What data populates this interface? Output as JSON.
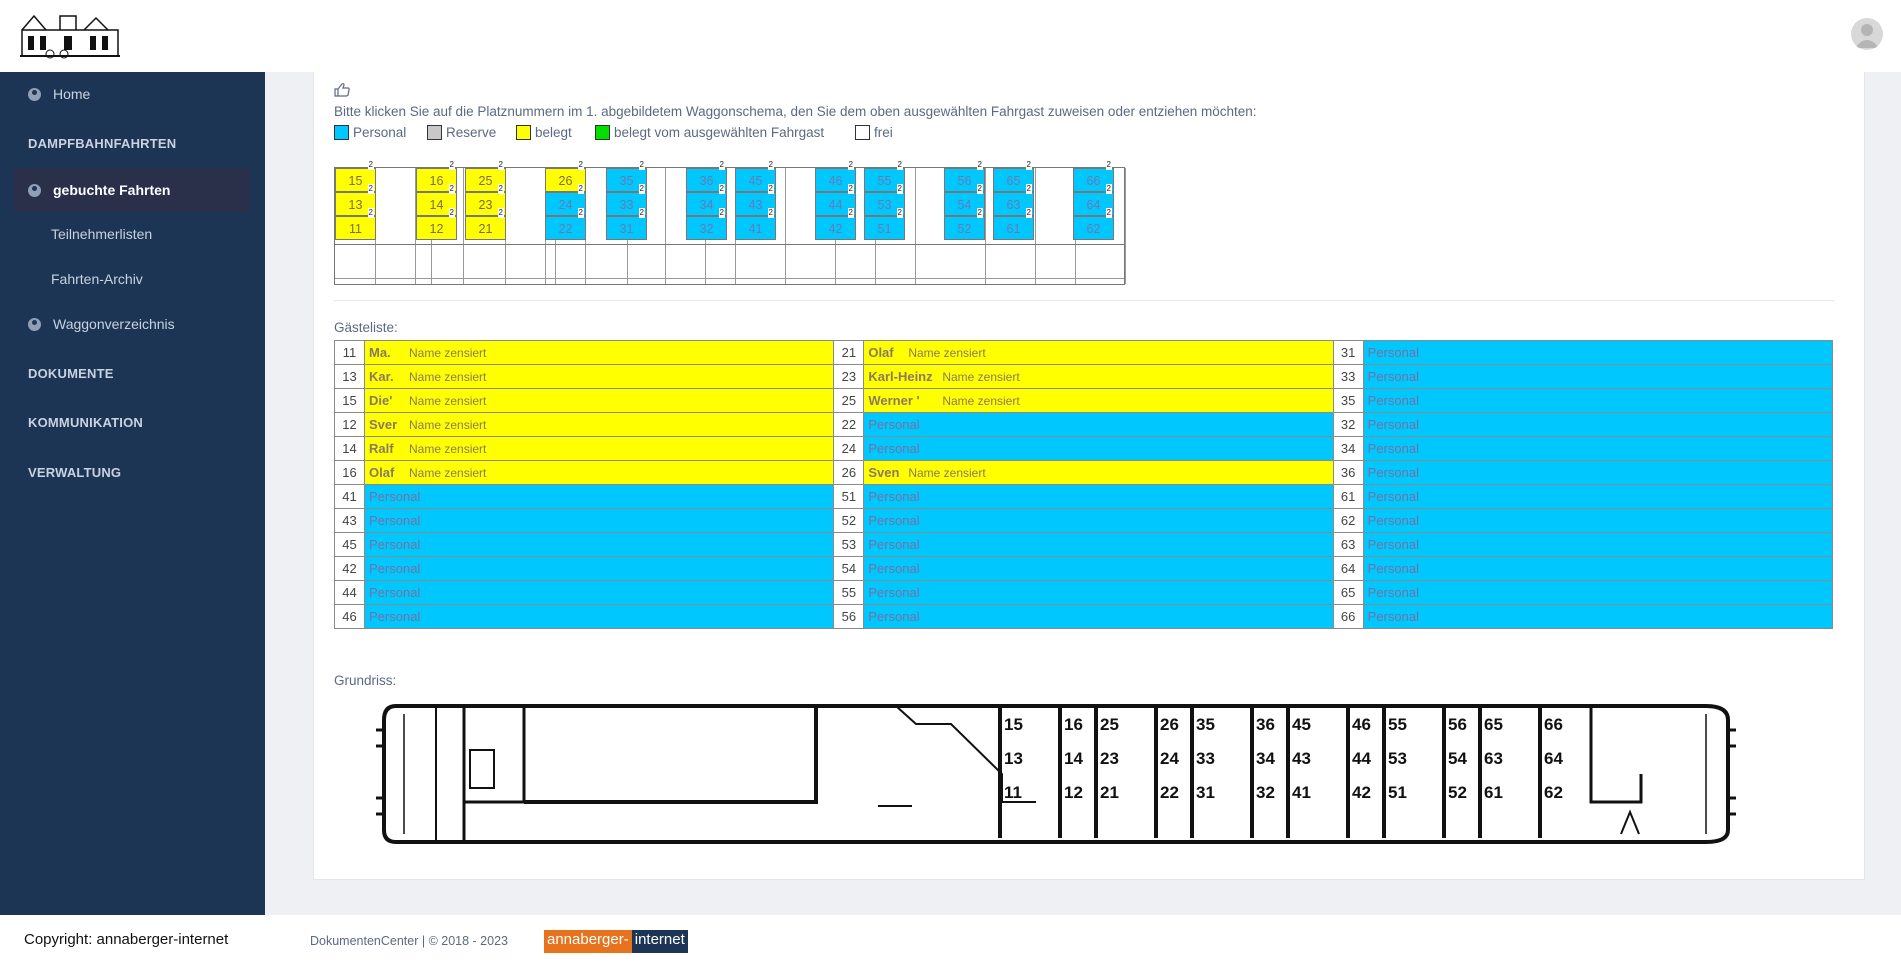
{
  "nav": {
    "home": "Home",
    "dampfbahnfahrten": "DAMPFBAHNFAHRTEN",
    "gebuchte_fahrten": "gebuchte Fahrten",
    "teilnehmerlisten": "Teilnehmerlisten",
    "fahrten_archiv": "Fahrten-Archiv",
    "waggonverzeichnis": "Waggonverzeichnis",
    "dokumente": "DOKUMENTE",
    "kommunikation": "KOMMUNIKATION",
    "verwaltung": "VERWALTUNG"
  },
  "content": {
    "pointer_icon": "hand-pointer-icon",
    "instruction": "Bitte klicken Sie auf die Platznummern im 1. abgebildetem Waggonschema, den Sie dem oben ausgewählten Fahrgast zuweisen oder entziehen möchten:",
    "legend": [
      {
        "label": "Personal",
        "color": "#00c8ff"
      },
      {
        "label": "Reserve",
        "color": "#c8c8c8"
      },
      {
        "label": "belegt",
        "color": "#ffff00"
      },
      {
        "label": "belegt vom ausgewählten Fahrgast",
        "color": "#00e000"
      },
      {
        "label": "frei",
        "color": "#ffffff"
      }
    ],
    "guestlist_title": "Gästeliste:",
    "floorplan_title": "Grundriss:"
  },
  "seatmap": {
    "seat_badge": "2",
    "rows": [
      [
        "15",
        "16",
        "25",
        "26",
        "35",
        "36",
        "45",
        "46",
        "55",
        "56",
        "65",
        "66"
      ],
      [
        "13",
        "14",
        "23",
        "24",
        "33",
        "34",
        "43",
        "44",
        "53",
        "54",
        "63",
        "64"
      ],
      [
        "11",
        "12",
        "21",
        "22",
        "31",
        "32",
        "41",
        "42",
        "51",
        "52",
        "61",
        "62"
      ]
    ],
    "occupied": [
      "11",
      "12",
      "13",
      "14",
      "15",
      "16",
      "21",
      "23",
      "25",
      "26"
    ]
  },
  "guests": {
    "name_placeholder": "Name zensiert",
    "staff_label": "Personal",
    "rows": [
      [
        {
          "n": "11",
          "name": "Ma."
        },
        {
          "n": "21",
          "name": "Olaf"
        },
        {
          "n": "31"
        }
      ],
      [
        {
          "n": "13",
          "name": "Kar."
        },
        {
          "n": "23",
          "name": "Karl-Heinz"
        },
        {
          "n": "33"
        }
      ],
      [
        {
          "n": "15",
          "name": "Die'"
        },
        {
          "n": "25",
          "name": "Werner '"
        },
        {
          "n": "35"
        }
      ],
      [
        {
          "n": "12",
          "name": "Sver"
        },
        {
          "n": "22"
        },
        {
          "n": "32"
        }
      ],
      [
        {
          "n": "14",
          "name": "Ralf"
        },
        {
          "n": "24"
        },
        {
          "n": "34"
        }
      ],
      [
        {
          "n": "16",
          "name": "Olaf"
        },
        {
          "n": "26",
          "name": "Sven"
        },
        {
          "n": "36"
        }
      ],
      [
        {
          "n": "41"
        },
        {
          "n": "51"
        },
        {
          "n": "61"
        }
      ],
      [
        {
          "n": "43"
        },
        {
          "n": "52"
        },
        {
          "n": "62"
        }
      ],
      [
        {
          "n": "45"
        },
        {
          "n": "53"
        },
        {
          "n": "63"
        }
      ],
      [
        {
          "n": "42"
        },
        {
          "n": "54"
        },
        {
          "n": "64"
        }
      ],
      [
        {
          "n": "44"
        },
        {
          "n": "55"
        },
        {
          "n": "65"
        }
      ],
      [
        {
          "n": "46"
        },
        {
          "n": "56"
        },
        {
          "n": "66"
        }
      ]
    ]
  },
  "floorplan": {
    "blocks": [
      [
        "15",
        "13",
        "11"
      ],
      [
        "16",
        "14",
        "12"
      ],
      [
        "25",
        "23",
        "21"
      ],
      [
        "26",
        "24",
        "22"
      ],
      [
        "35",
        "33",
        "31"
      ],
      [
        "36",
        "34",
        "32"
      ],
      [
        "45",
        "43",
        "41"
      ],
      [
        "46",
        "44",
        "42"
      ],
      [
        "55",
        "53",
        "51"
      ],
      [
        "56",
        "54",
        "52"
      ],
      [
        "65",
        "63",
        "61"
      ],
      [
        "66",
        "64",
        "62"
      ]
    ]
  },
  "footer": {
    "copyright": "Copyright: annaberger-internet",
    "dc": "DokumentenCenter  |  © 2018 - 2023",
    "brand_a": "annaberger-",
    "brand_b": "internet"
  },
  "icons": {
    "logo": "station-building-logo",
    "avatar": "user-avatar-icon",
    "nav_circle": "user-circle-icon"
  }
}
